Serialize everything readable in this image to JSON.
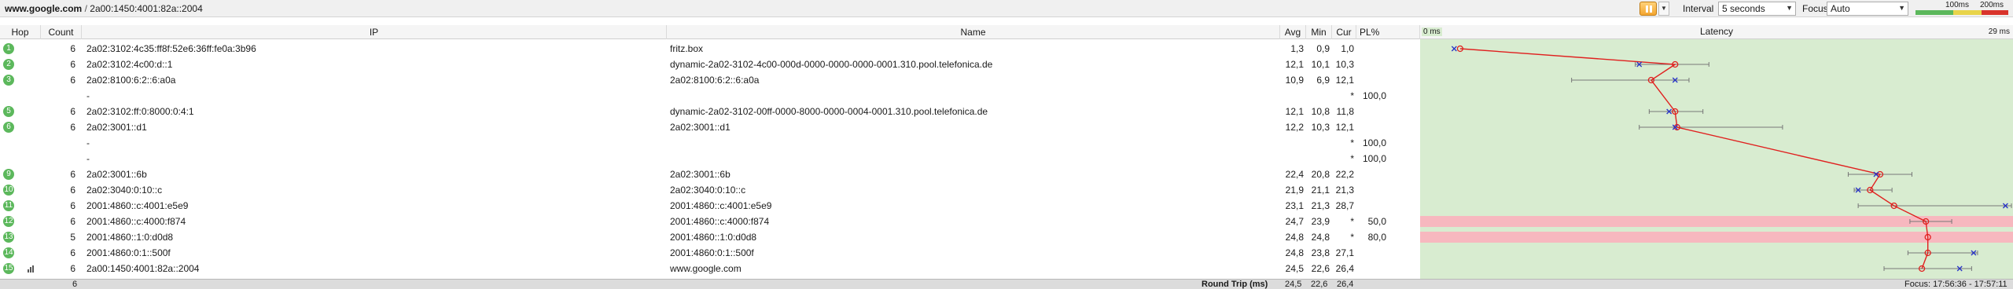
{
  "target": {
    "host": "www.google.com",
    "separator": "/",
    "ip": "2a00:1450:4001:82a::2004"
  },
  "toolbar": {
    "interval_label": "Interval",
    "interval_value": "5 seconds",
    "focus_label": "Focus",
    "focus_value": "Auto",
    "scale_100": "100ms",
    "scale_200": "200ms"
  },
  "columns": {
    "hop": "Hop",
    "count": "Count",
    "ip": "IP",
    "name": "Name",
    "avg": "Avg",
    "min": "Min",
    "cur": "Cur",
    "pl": "PL%",
    "latency": "Latency"
  },
  "graph": {
    "min_label": "0 ms",
    "max_label": "29 ms",
    "max_ms": 29
  },
  "hops": [
    {
      "hop": "1",
      "count": "6",
      "ip": "2a02:3102:4c35:ff8f:52e6:36ff:fe0a:3b96",
      "name": "fritz.box",
      "avg": "1,3",
      "min": "0,9",
      "cur": "1,0",
      "pl": ""
    },
    {
      "hop": "2",
      "count": "6",
      "ip": "2a02:3102:4c00:d::1",
      "name": "dynamic-2a02-3102-4c00-000d-0000-0000-0000-0001.310.pool.telefonica.de",
      "avg": "12,1",
      "min": "10,1",
      "cur": "10,3",
      "pl": ""
    },
    {
      "hop": "3",
      "count": "6",
      "ip": "2a02:8100:6:2::6:a0a",
      "name": "2a02:8100:6:2::6:a0a",
      "avg": "10,9",
      "min": "6,9",
      "cur": "12,1",
      "pl": ""
    },
    {
      "hop": "",
      "count": "",
      "ip": "-",
      "name": "",
      "avg": "",
      "min": "",
      "cur": "*",
      "pl": "100,0"
    },
    {
      "hop": "5",
      "count": "6",
      "ip": "2a02:3102:ff:0:8000:0:4:1",
      "name": "dynamic-2a02-3102-00ff-0000-8000-0000-0004-0001.310.pool.telefonica.de",
      "avg": "12,1",
      "min": "10,8",
      "cur": "11,8",
      "pl": ""
    },
    {
      "hop": "6",
      "count": "6",
      "ip": "2a02:3001::d1",
      "name": "2a02:3001::d1",
      "avg": "12,2",
      "min": "10,3",
      "cur": "12,1",
      "pl": ""
    },
    {
      "hop": "",
      "count": "",
      "ip": "-",
      "name": "",
      "avg": "",
      "min": "",
      "cur": "*",
      "pl": "100,0"
    },
    {
      "hop": "",
      "count": "",
      "ip": "-",
      "name": "",
      "avg": "",
      "min": "",
      "cur": "*",
      "pl": "100,0"
    },
    {
      "hop": "9",
      "count": "6",
      "ip": "2a02:3001::6b",
      "name": "2a02:3001::6b",
      "avg": "22,4",
      "min": "20,8",
      "cur": "22,2",
      "pl": ""
    },
    {
      "hop": "10",
      "count": "6",
      "ip": "2a02:3040:0:10::c",
      "name": "2a02:3040:0:10::c",
      "avg": "21,9",
      "min": "21,1",
      "cur": "21,3",
      "pl": ""
    },
    {
      "hop": "11",
      "count": "6",
      "ip": "2001:4860::c:4001:e5e9",
      "name": "2001:4860::c:4001:e5e9",
      "avg": "23,1",
      "min": "21,3",
      "cur": "28,7",
      "pl": ""
    },
    {
      "hop": "12",
      "count": "6",
      "ip": "2001:4860::c:4000:f874",
      "name": "2001:4860::c:4000:f874",
      "avg": "24,7",
      "min": "23,9",
      "cur": "*",
      "pl": "50,0"
    },
    {
      "hop": "13",
      "count": "5",
      "ip": "2001:4860::1:0:d0d8",
      "name": "2001:4860::1:0:d0d8",
      "avg": "24,8",
      "min": "24,8",
      "cur": "*",
      "pl": "80,0"
    },
    {
      "hop": "14",
      "count": "6",
      "ip": "2001:4860:0:1::500f",
      "name": "2001:4860:0:1::500f",
      "avg": "24,8",
      "min": "23,8",
      "cur": "27,1",
      "pl": ""
    },
    {
      "hop": "15",
      "count": "6",
      "ip": "2a00:1450:4001:82a::2004",
      "name": "www.google.com",
      "avg": "24,5",
      "min": "22,6",
      "cur": "26,4",
      "pl": ""
    }
  ],
  "latency_marks": [
    {
      "row": 0,
      "avg": 1.3,
      "cur": 1.0,
      "lo": null,
      "hi": null
    },
    {
      "row": 1,
      "avg": 12.1,
      "cur": 10.3,
      "lo": 10.1,
      "hi": 13.8
    },
    {
      "row": 2,
      "avg": 10.9,
      "cur": 12.1,
      "lo": 6.9,
      "hi": 12.8
    },
    {
      "row": 4,
      "avg": 12.1,
      "cur": 11.8,
      "lo": 10.8,
      "hi": 13.5
    },
    {
      "row": 5,
      "avg": 12.2,
      "cur": 12.1,
      "lo": 10.3,
      "hi": 17.5
    },
    {
      "row": 8,
      "avg": 22.4,
      "cur": 22.2,
      "lo": 20.8,
      "hi": 24.0
    },
    {
      "row": 9,
      "avg": 21.9,
      "cur": 21.3,
      "lo": 21.1,
      "hi": 23.0
    },
    {
      "row": 10,
      "avg": 23.1,
      "cur": 28.7,
      "lo": 21.3,
      "hi": 29.0
    },
    {
      "row": 11,
      "avg": 24.7,
      "cur": null,
      "lo": 23.9,
      "hi": 26.0
    },
    {
      "row": 12,
      "avg": 24.8,
      "cur": null,
      "lo": 24.8,
      "hi": 24.8
    },
    {
      "row": 13,
      "avg": 24.8,
      "cur": 27.1,
      "lo": 23.8,
      "hi": 27.3
    },
    {
      "row": 14,
      "avg": 24.5,
      "cur": 26.4,
      "lo": 22.6,
      "hi": 27.0
    }
  ],
  "footer": {
    "count": "6",
    "round_trip_label": "Round Trip (ms)",
    "avg": "24,5",
    "min": "22,6",
    "cur": "26,4",
    "focus": "Focus: 17:56:36 - 17:57:11"
  },
  "colors": {
    "graph_bg": "#d8ecd0",
    "loss_band": "#f7b8bf",
    "line": "#e0201f",
    "cur_marker": "#2a35c8",
    "hop_badge": "#5cb85c",
    "scale_green": "#5cb85c",
    "scale_yellow": "#e8d44a",
    "scale_red": "#d9342b"
  }
}
